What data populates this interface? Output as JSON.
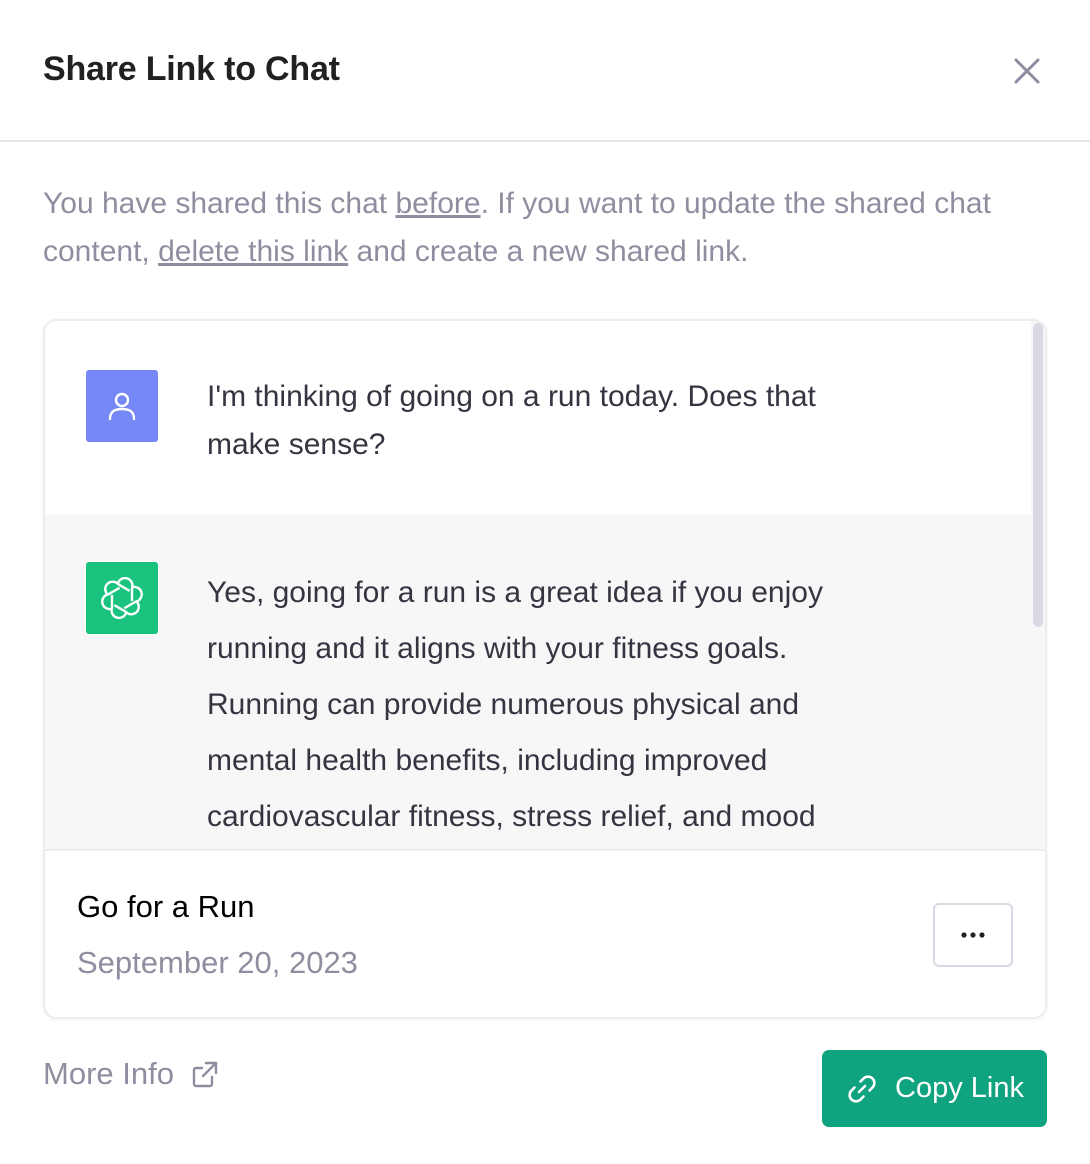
{
  "dialog": {
    "title": "Share Link to Chat",
    "notice": {
      "part1": "You have shared this chat ",
      "link_before": "before",
      "part2": ". If you want to update the shared chat content, ",
      "link_delete": "delete this link",
      "part3": " and create a new shared link."
    }
  },
  "preview": {
    "messages": [
      {
        "role": "user",
        "icon": "user-icon",
        "text": "I'm thinking of going on a run today. Does that make sense?"
      },
      {
        "role": "assistant",
        "icon": "openai-logo-icon",
        "text": "Yes, going for a run is a great idea if you enjoy running and it aligns with your fitness goals. Running can provide numerous physical and mental health benefits, including improved cardiovascular fitness, stress relief, and mood"
      }
    ]
  },
  "card_footer": {
    "chat_title": "Go for a Run",
    "date": "September 20, 2023",
    "more_icon": "ellipsis-icon"
  },
  "footer": {
    "more_info_label": "More Info",
    "more_info_icon": "external-link-icon",
    "copy_link_label": "Copy Link",
    "copy_link_icon": "link-icon"
  },
  "colors": {
    "accent": "#10a37f",
    "user_avatar": "#7688f8",
    "assistant_avatar": "#19c37d",
    "muted_text": "#8e8ea0"
  }
}
